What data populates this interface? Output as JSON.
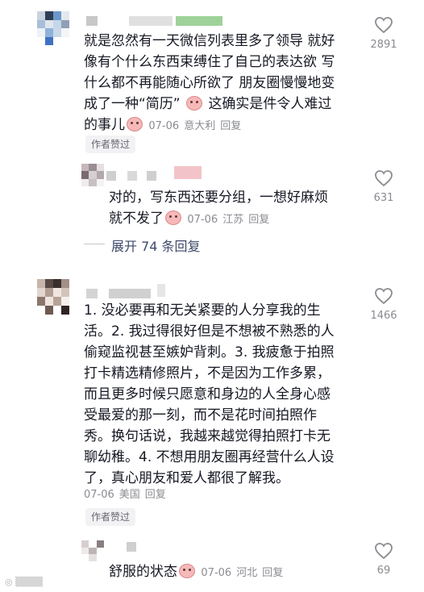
{
  "comments": [
    {
      "text_lines": [
        "就是忽然有一天微信列表里多了领导 就好",
        "像有个什么东西束缚住了自己的表达欲 写",
        "什么都不再能随心所欲了 朋友圈慢慢地变",
        "成了一种“简历”",
        "这确实是件令人难过",
        "的事儿"
      ],
      "date": "07-06",
      "location": "意大利",
      "reply_label": "回复",
      "badge": "作者赞过",
      "likes": "2891"
    },
    {
      "text_lines": [
        "对的，写东西还要分组，一想好麻烦",
        "就不发了"
      ],
      "date": "07-06",
      "location": "江苏",
      "reply_label": "回复",
      "likes": "631"
    },
    {
      "text_lines": [
        "1. 没必要再和无关紧要的人分享我的生",
        "活。2. 我过得很好但是不想被不熟悉的人",
        "偷窥监视甚至嫉妒背刺。3. 我疲惫于拍照",
        "打卡精选精修照片，不是因为工作多累，",
        "而且更多时候只愿意和身边的人全身心感",
        "受最爱的那一刻，而不是花时间拍照作",
        "秀。换句话说，我越来越觉得拍照打卡无",
        "聊幼稚。4. 不想用朋友圈再经营什么人设",
        "了，真心朋友和爱人都很了解我。"
      ],
      "date": "07-06",
      "location": "美国",
      "reply_label": "回复",
      "badge": "作者赞过",
      "likes": "1466"
    },
    {
      "text_lines": [
        "舒服的状态"
      ],
      "date": "07-06",
      "location": "河北",
      "reply_label": "回复",
      "likes": "69"
    }
  ],
  "expand_replies": "展开 74 条回复",
  "icons": {
    "like": "heart-outline-icon",
    "sticker": "blush-face-emoji-icon"
  },
  "colors": {
    "text": "#161823",
    "meta": "#8a8b91",
    "expand": "#3d4a6b",
    "badge_bg": "#f2f2f4"
  }
}
